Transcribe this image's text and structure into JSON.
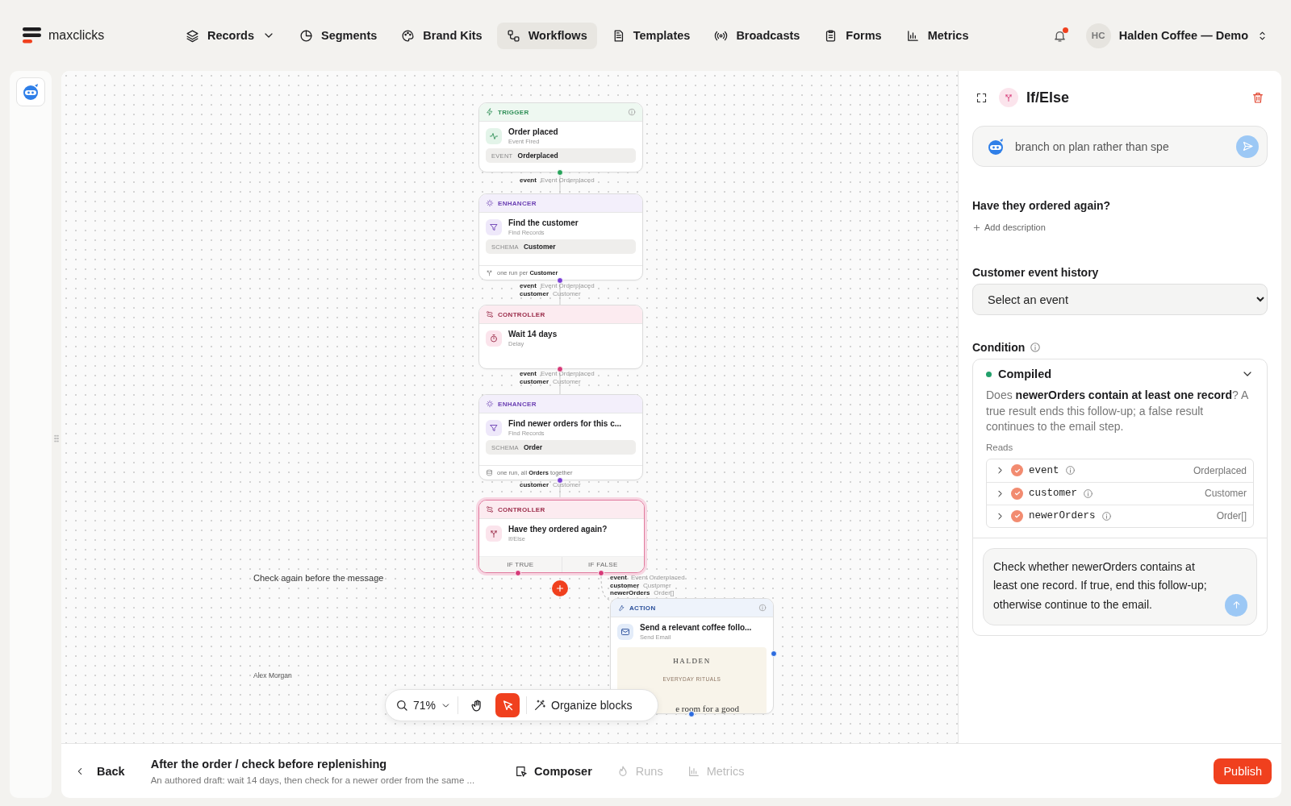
{
  "app": {
    "logo": "maxclicks"
  },
  "nav": [
    {
      "label": "Records",
      "dropdown": true,
      "selected": false
    },
    {
      "label": "Segments",
      "dropdown": false,
      "selected": false
    },
    {
      "label": "Brand Kits",
      "dropdown": false,
      "selected": false
    },
    {
      "label": "Workflows",
      "dropdown": false,
      "selected": true
    },
    {
      "label": "Templates",
      "dropdown": false,
      "selected": false
    },
    {
      "label": "Broadcasts",
      "dropdown": false,
      "selected": false
    },
    {
      "label": "Forms",
      "dropdown": false,
      "selected": false
    },
    {
      "label": "Metrics",
      "dropdown": false,
      "selected": false
    }
  ],
  "notifications": {
    "unread": true
  },
  "account": {
    "initials": "HC",
    "name": "Halden Coffee — Demo"
  },
  "canvas": {
    "nodes": [
      {
        "kind": "trigger",
        "category": "TRIGGER",
        "info": true,
        "selected": false,
        "title": "Order placed",
        "subtitle": "Event Fired",
        "field": {
          "label": "EVENT",
          "value": "Orderplaced"
        },
        "outputs": [
          {
            "name": "event",
            "type": "Event Orderplaced"
          }
        ]
      },
      {
        "kind": "enhancer",
        "category": "ENHANCER",
        "info": false,
        "selected": false,
        "title": "Find the customer",
        "subtitle": "Find Records",
        "field": {
          "label": "SCHEMA",
          "value": "Customer"
        },
        "footer": "one run per **Customer**",
        "outputs": [
          {
            "name": "event",
            "type": "Event Orderplaced"
          },
          {
            "name": "customer",
            "type": "Customer"
          }
        ]
      },
      {
        "kind": "controller",
        "category": "CONTROLLER",
        "info": false,
        "selected": false,
        "title": "Wait 14 days",
        "subtitle": "Delay",
        "outputs": [
          {
            "name": "event",
            "type": "Event Orderplaced"
          },
          {
            "name": "customer",
            "type": "Customer"
          }
        ]
      },
      {
        "kind": "enhancer",
        "category": "ENHANCER",
        "info": false,
        "selected": false,
        "title": "Find newer orders for this c...",
        "subtitle": "Find Records",
        "field": {
          "label": "SCHEMA",
          "value": "Order"
        },
        "footer": "one run, all **Orders** together",
        "outputs": [
          {
            "name": "customer",
            "type": "Customer"
          }
        ]
      },
      {
        "kind": "controller",
        "category": "CONTROLLER",
        "info": false,
        "selected": true,
        "title": "Have they ordered again?",
        "subtitle": "If/Else",
        "branches": [
          "IF TRUE",
          "IF FALSE"
        ],
        "outputs": [
          {
            "name": "event",
            "type": "Event Orderplaced"
          },
          {
            "name": "customer",
            "type": "Customer"
          },
          {
            "name": "newerOrders",
            "type": "Order[]"
          }
        ]
      },
      {
        "kind": "action",
        "category": "ACTION",
        "info": true,
        "selected": false,
        "title": "Send a relevant coffee follo...",
        "subtitle": "Send Email",
        "preview": {
          "brand": "HALDEN",
          "tagline": "EVERYDAY RITUALS",
          "text": "e room for a good"
        }
      }
    ],
    "comment": {
      "text": "Check again before the message",
      "author": "Alex Morgan"
    },
    "toolbar": {
      "zoom": "71%",
      "tools": [
        {
          "kind": "hand",
          "selected": false
        },
        {
          "kind": "pointer",
          "selected": true
        }
      ],
      "organize": "Organize blocks"
    }
  },
  "inspector": {
    "title": "If/Else",
    "ai_prompt": {
      "value": "branch on plan rather than spe"
    },
    "name": "Have they ordered again?",
    "add_description": "Add description",
    "event_history": {
      "label": "Customer event history",
      "value": "Select an event"
    },
    "condition": {
      "label": "Condition",
      "status": {
        "label": "Compiled",
        "kind": "ok"
      },
      "expanded": true,
      "summary": "Does **newerOrders contain at least one record**? A true result ends this follow-up; a false result continues to the email step.",
      "reads_label": "Reads",
      "reads": [
        {
          "name": "event",
          "type": "Orderplaced"
        },
        {
          "name": "customer",
          "type": "Customer"
        },
        {
          "name": "newerOrders",
          "type": "Order[]"
        }
      ],
      "instruction": {
        "value": "Check whether newerOrders contains at least one record. If true, end this follow-up; otherwise continue to the email."
      }
    }
  },
  "footer": {
    "back": "Back",
    "title": "After the order / check before replenishing",
    "description": "An authored draft: wait 14 days, then check for a newer order from the same ...",
    "views": [
      {
        "label": "Composer",
        "selected": true
      },
      {
        "label": "Runs",
        "selected": false
      },
      {
        "label": "Metrics",
        "selected": false
      }
    ],
    "publish": "Publish"
  }
}
